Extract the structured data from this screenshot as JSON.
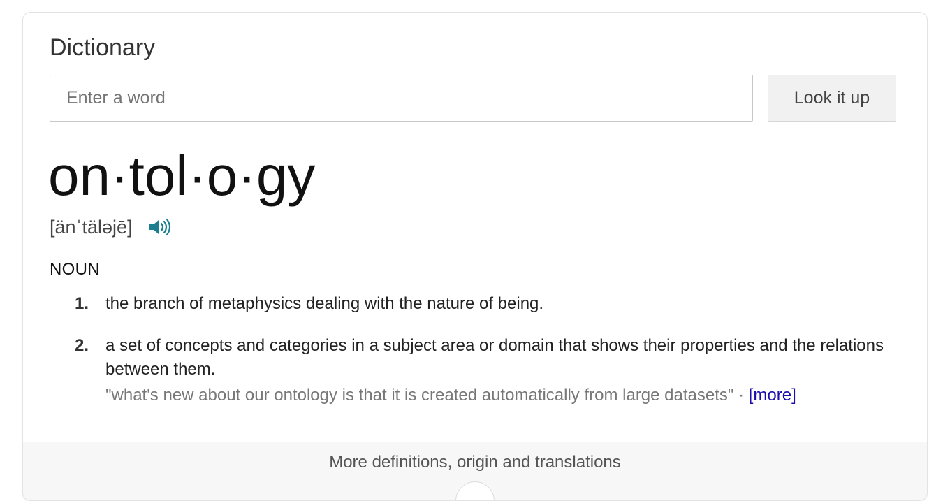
{
  "dictionary": {
    "title": "Dictionary",
    "search": {
      "placeholder": "Enter a word",
      "value": ""
    },
    "lookup_button_label": "Look it up"
  },
  "entry": {
    "headword": "on·tol·o·gy",
    "pronunciation": "[änˈtäləjē]",
    "speaker_icon": "speaker-icon",
    "part_of_speech": "NOUN",
    "definitions": [
      {
        "number": "1.",
        "text": "the branch of metaphysics dealing with the nature of being."
      },
      {
        "number": "2.",
        "text": "a set of concepts and categories in a subject area or domain that shows their properties and the relations between them.",
        "example": "\"what's new about our ontology is that it is created automatically from large datasets\"",
        "separator": " · ",
        "more_label": "[more]"
      }
    ]
  },
  "footer": {
    "more_label": "More definitions, origin and translations"
  },
  "colors": {
    "accent_teal": "#1a7f8e",
    "link_blue": "#1a0dab"
  }
}
